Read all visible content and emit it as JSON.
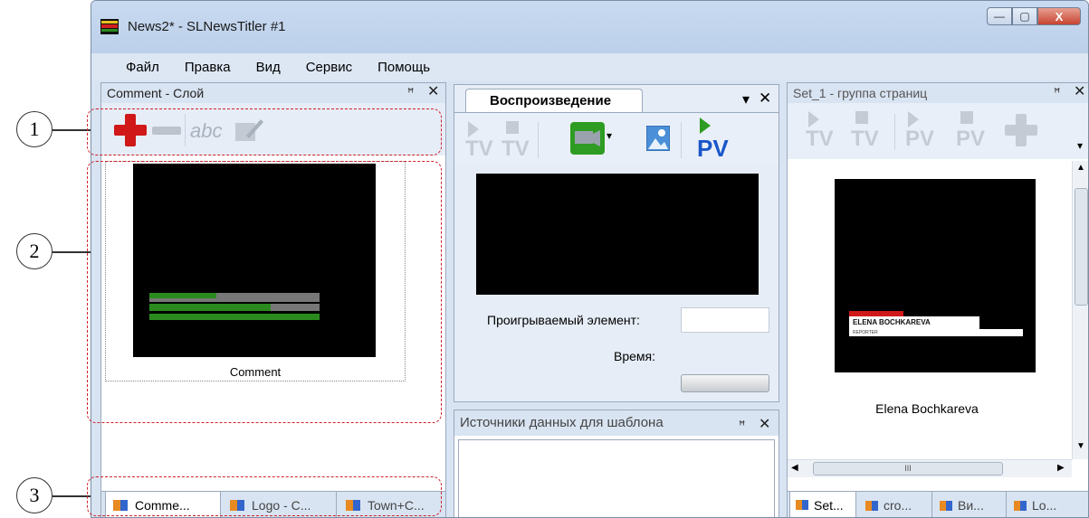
{
  "window": {
    "title": "News2* - SLNewsTitler #1",
    "min_symbol": "—",
    "max_symbol": "▢",
    "close_symbol": "X"
  },
  "menu": [
    "Файл",
    "Правка",
    "Вид",
    "Сервис",
    "Помощь"
  ],
  "left_panel": {
    "header": "Comment - Слой",
    "pin": "ꟸ",
    "close": "✕",
    "toolbar_text": "abc",
    "thumb_caption": "Comment",
    "tabs": [
      "Comme...",
      "Logo - C...",
      "Town+C..."
    ]
  },
  "center_panel": {
    "tab": "Воспроизведение",
    "dropdown": "▾",
    "close": "✕",
    "tv1": "TV",
    "tv2": "TV",
    "pv": "PV",
    "playing_label": "Проигрываемый элемент:",
    "time_label": "Время:"
  },
  "sources_panel": {
    "header": "Источники данных для шаблона",
    "pin": "ꟸ",
    "close": "✕"
  },
  "right_panel": {
    "header": "Set_1 - группа страниц",
    "pin": "ꟸ",
    "close": "✕",
    "btn_tv1": "TV",
    "btn_tv2": "TV",
    "btn_pv1": "PV",
    "btn_pv2": "PV",
    "lower_third_name": "ELENA BOCHKAREVA",
    "lower_third_role": "REPORTER",
    "thumb_caption": "Elena Bochkareva",
    "scroll_grip": "III",
    "tabs": [
      "Set...",
      "cro...",
      "Ви...",
      "Lo..."
    ]
  },
  "callouts": [
    "1",
    "2",
    "3"
  ],
  "colors": {
    "accent_red": "#d01818",
    "callout_dash": "#d0202c",
    "thumb_bg": "#000000",
    "green": "#2a8a1e"
  }
}
